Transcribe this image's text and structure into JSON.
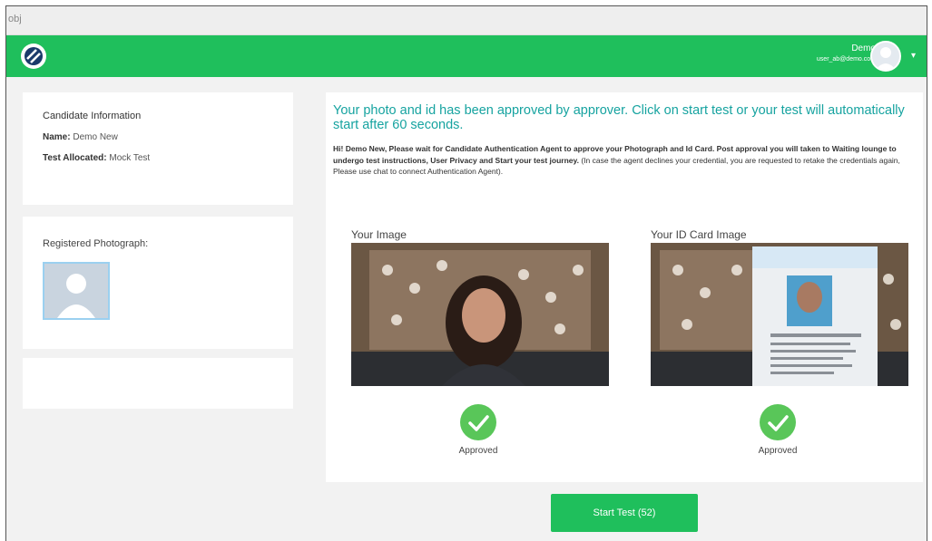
{
  "browser": {
    "tab_label": "obj"
  },
  "header": {
    "user_name": "Demo",
    "user_email": "user_ab@demo.com",
    "menu_caret": "▾",
    "accent_color": "#1fbf5c"
  },
  "candidate": {
    "heading": "Candidate Information",
    "name_label": "Name:",
    "name_value": "Demo New",
    "test_label": "Test Allocated:",
    "test_value": "Mock Test"
  },
  "registered": {
    "heading": "Registered Photograph:"
  },
  "approval": {
    "title": "Your photo and id has been approved by approver. Click on start test or your test will automatically start after 60 seconds.",
    "desc_bold": "Hi! Demo New, Please wait for Candidate Authentication Agent to approve your Photograph and Id Card. Post approval you will taken to Waiting lounge to undergo test instructions, User Privacy and Start your test journey.",
    "desc_note": "(In case the agent declines your credential, you are requested to retake the credentials again, Please use chat to connect Authentication Agent).",
    "your_image_label": "Your Image",
    "id_card_label": "Your ID Card Image",
    "image_status": "Approved",
    "id_status": "Approved"
  },
  "actions": {
    "start_test_label": "Start Test (52)"
  }
}
